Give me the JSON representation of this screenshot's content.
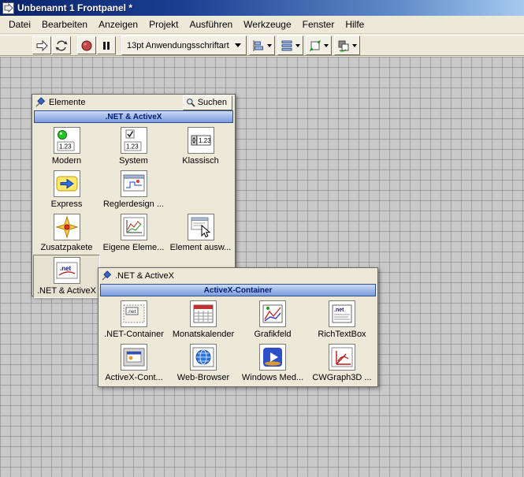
{
  "window": {
    "title": "Unbenannt 1 Frontpanel *"
  },
  "menubar": {
    "items": [
      "Datei",
      "Bearbeiten",
      "Anzeigen",
      "Projekt",
      "Ausführen",
      "Werkzeuge",
      "Fenster",
      "Hilfe"
    ]
  },
  "toolbar": {
    "font_selector": "13pt Anwendungsschriftart"
  },
  "icon_texts": {
    "numeric": "1.23",
    "dotnet": ".net"
  },
  "controls_palette": {
    "title": "Elemente",
    "search_label": "Suchen",
    "category": ".NET & ActiveX",
    "items": [
      {
        "label": "Modern",
        "icon": "modern-controls-icon"
      },
      {
        "label": "System",
        "icon": "system-controls-icon"
      },
      {
        "label": "Klassisch",
        "icon": "classic-controls-icon"
      },
      {
        "label": "Express",
        "icon": "express-controls-icon"
      },
      {
        "label": "Reglerdesign ...",
        "icon": "control-design-icon"
      },
      {
        "label": "Zusatzpakete",
        "icon": "addons-icon"
      },
      {
        "label": "Eigene Eleme...",
        "icon": "user-controls-icon"
      },
      {
        "label": "Element ausw...",
        "icon": "select-control-icon"
      },
      {
        "label": ".NET & ActiveX",
        "icon": "dotnet-activex-icon",
        "selected": true
      }
    ]
  },
  "subpalette": {
    "title": ".NET & ActiveX",
    "category": "ActiveX-Container",
    "items": [
      {
        "label": ".NET-Container",
        "icon": "dotnet-container-icon"
      },
      {
        "label": "Monatskalender",
        "icon": "month-calendar-icon"
      },
      {
        "label": "Grafikfeld",
        "icon": "picture-field-icon"
      },
      {
        "label": "RichTextBox",
        "icon": "richtextbox-icon"
      },
      {
        "label": "ActiveX-Cont...",
        "icon": "activex-container-icon"
      },
      {
        "label": "Web-Browser",
        "icon": "web-browser-icon"
      },
      {
        "label": "Windows Med...",
        "icon": "windows-media-icon"
      },
      {
        "label": "CWGraph3D ...",
        "icon": "cwgraph3d-icon"
      }
    ]
  }
}
